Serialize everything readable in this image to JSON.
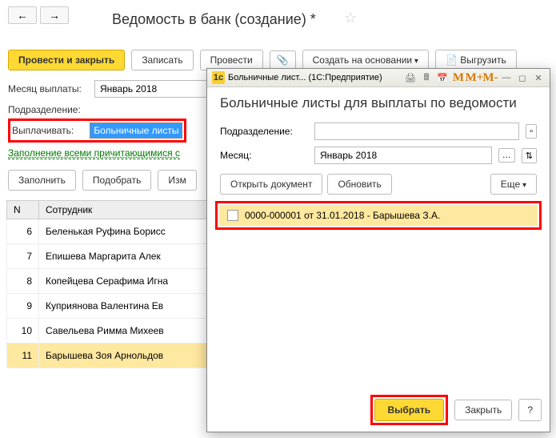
{
  "nav": {
    "back": "←",
    "forward": "→"
  },
  "title": "Ведомость в банк (создание) *",
  "toolbar": {
    "submit_close": "Провести и закрыть",
    "save": "Записать",
    "submit": "Провести",
    "create_based": "Создать на основании",
    "export": "Выгрузить"
  },
  "form": {
    "month_label": "Месяц выплаты:",
    "month_value": "Январь 2018",
    "dept_label": "Подразделение:",
    "pay_label": "Выплачивать:",
    "pay_value": "Больничные листы",
    "fill_link": "Заполнение всеми причитающимися с"
  },
  "actions": {
    "fill": "Заполнить",
    "pick": "Подобрать",
    "edit": "Изм"
  },
  "table": {
    "col_n": "N",
    "col_emp": "Сотрудник",
    "rows": [
      {
        "n": "6",
        "name": "Беленькая Руфина Борисс"
      },
      {
        "n": "7",
        "name": "Епишева Маргарита Алек"
      },
      {
        "n": "8",
        "name": "Копейцева Серафима Игна"
      },
      {
        "n": "9",
        "name": "Куприянова Валентина Ев"
      },
      {
        "n": "10",
        "name": "Савельева Римма Михеев"
      },
      {
        "n": "11",
        "name": "Барышева Зоя Арнольдов"
      }
    ]
  },
  "dialog": {
    "title": "Больничные лист... (1С:Предприятие)",
    "heading": "Больничные листы для выплаты по ведомости",
    "dept_label": "Подразделение:",
    "dept_value": "",
    "month_label": "Месяц:",
    "month_value": "Январь 2018",
    "open_doc": "Открыть документ",
    "refresh": "Обновить",
    "more": "Еще",
    "item": "0000-000001 от 31.01.2018 - Барышева З.А.",
    "select": "Выбрать",
    "close": "Закрыть",
    "help": "?",
    "m": "M",
    "mp": "M+",
    "mm": "M-"
  }
}
